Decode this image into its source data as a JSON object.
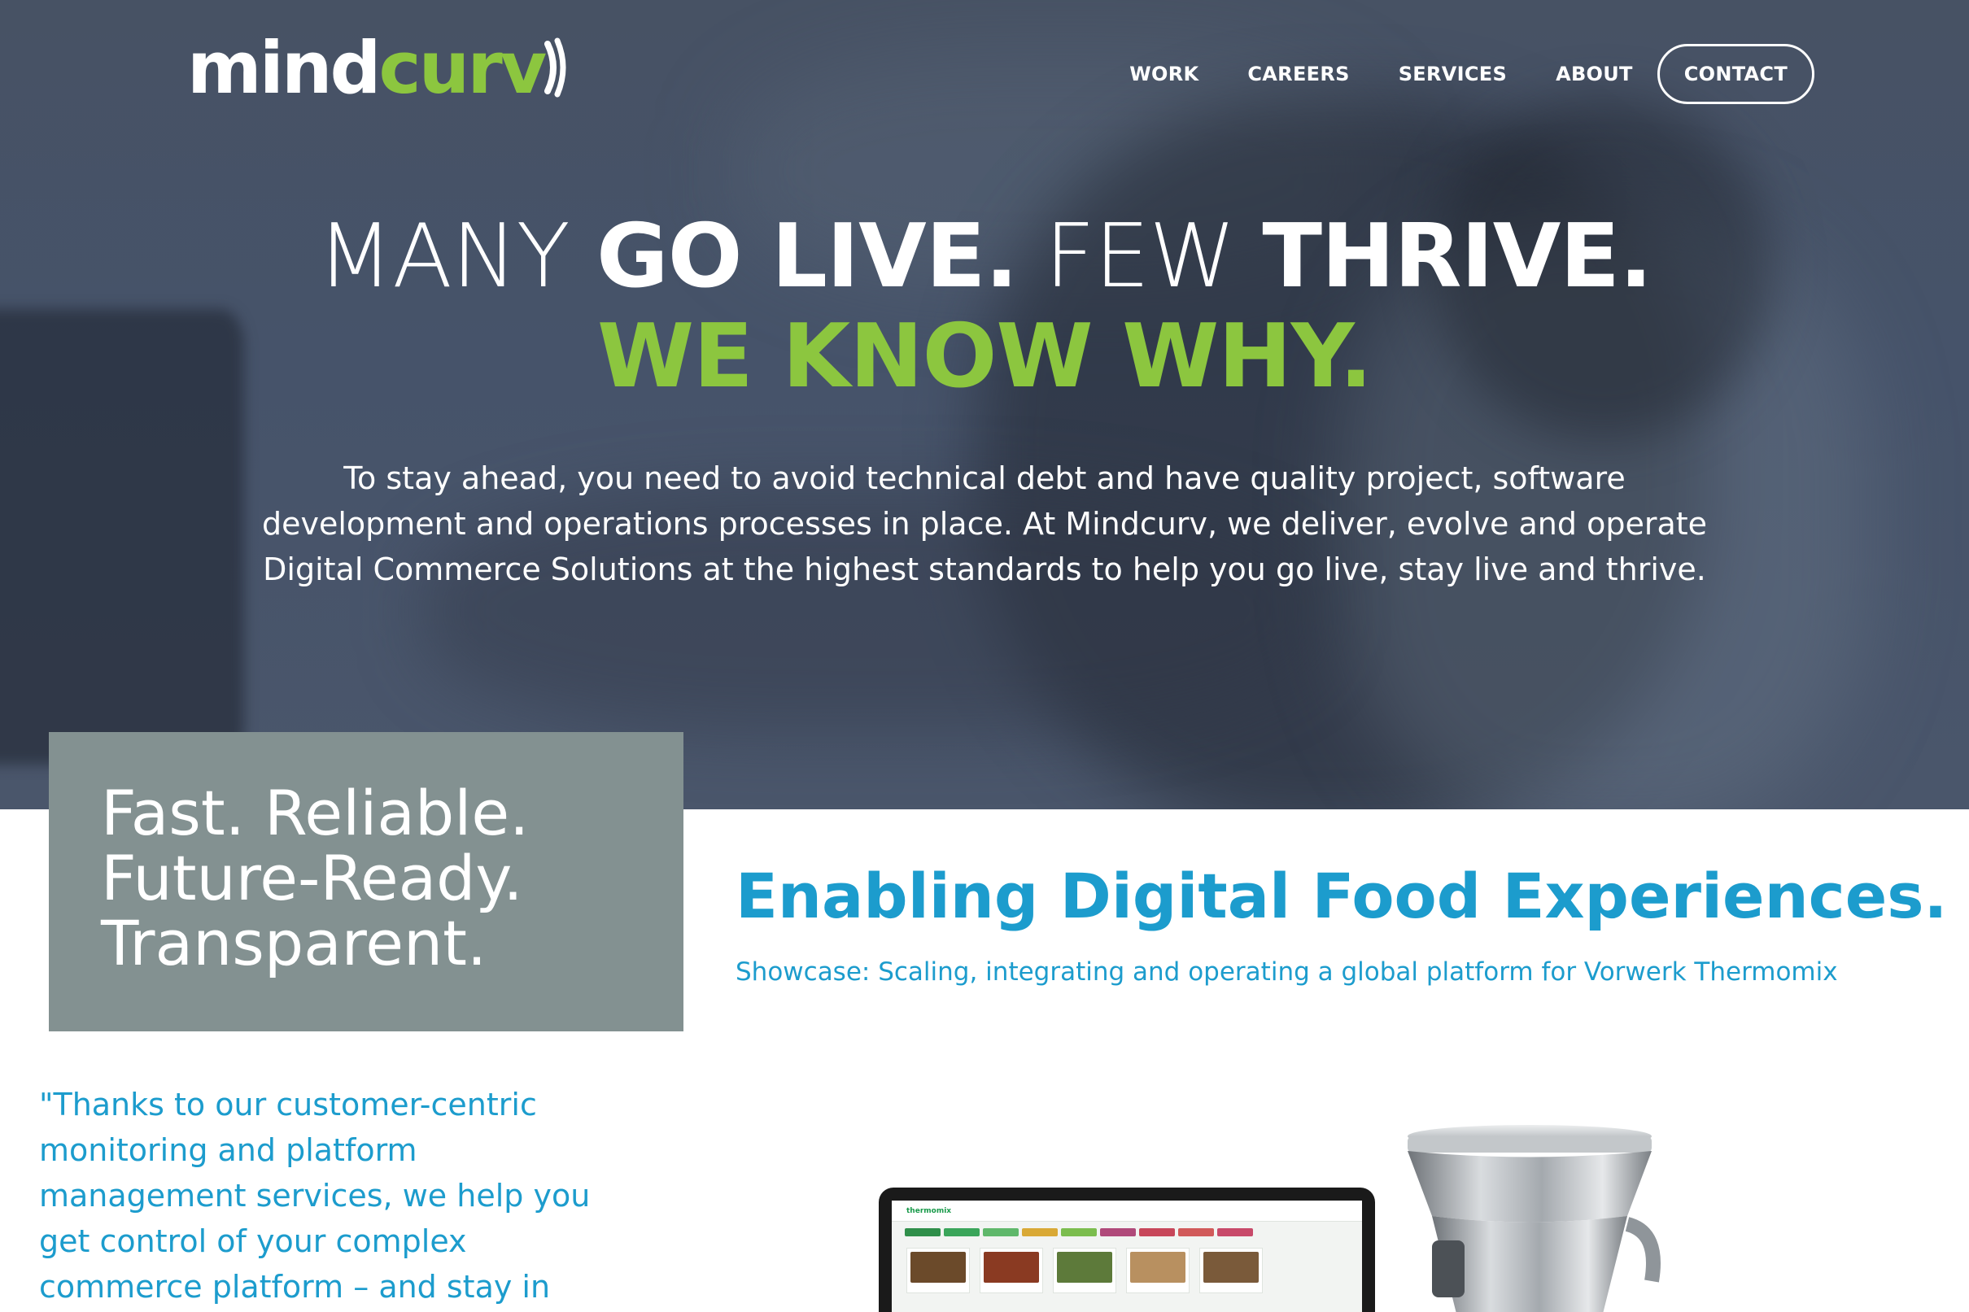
{
  "brand": {
    "logo_part1": "mind",
    "logo_part2": "curv"
  },
  "nav": {
    "items": [
      "WORK",
      "CAREERS",
      "SERVICES",
      "ABOUT"
    ],
    "contact": "CONTACT"
  },
  "hero": {
    "line1_a": "MANY ",
    "line1_b": "GO LIVE.",
    "line1_c": " FEW ",
    "line1_d": "THRIVE.",
    "line2": "WE KNOW WHY.",
    "intro": "To stay ahead, you need to avoid technical debt and have quality project, software development and operations processes in place. At Mindcurv, we deliver, evolve and operate Digital Commerce Solutions at the highest standards to help you go live, stay live and thrive."
  },
  "feature": {
    "lines": [
      "Fast. Reliable.",
      "Future-Ready.",
      "Transparent."
    ]
  },
  "showcase": {
    "title": "Enabling Digital Food Experiences.",
    "subtitle": "Showcase: Scaling, integrating and operating a global platform for Vorwerk Thermomix",
    "laptop_brand": "thermomix"
  },
  "quote": {
    "text": "\"Thanks to our customer-centric monitoring and platform management services, we help you get control of your complex commerce platform – and stay in"
  },
  "colors": {
    "accent_green": "#8cc63f",
    "accent_blue": "#1c9ccd",
    "hero_bg": "#475264",
    "feature_box": "#839191"
  }
}
